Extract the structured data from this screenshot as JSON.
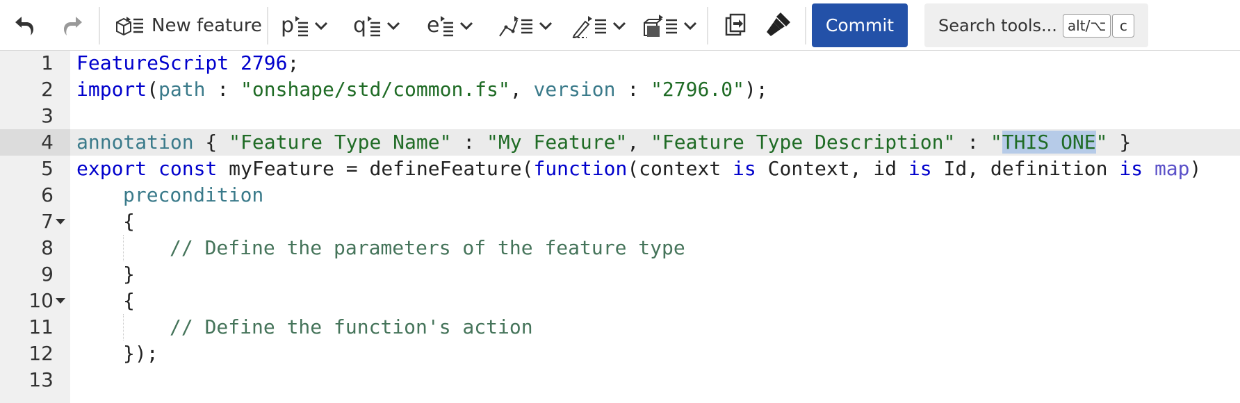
{
  "toolbar": {
    "undo_icon": "undo-icon",
    "redo_icon": "redo-icon",
    "new_feature_label": "New feature",
    "insert_tools": [
      {
        "glyph": "p",
        "name": "insert-parameter"
      },
      {
        "glyph": "q",
        "name": "insert-query"
      },
      {
        "glyph": "e",
        "name": "insert-enum"
      },
      {
        "glyph": "",
        "name": "insert-sketch"
      },
      {
        "glyph": "",
        "name": "insert-geometry"
      },
      {
        "glyph": "",
        "name": "insert-feature"
      }
    ],
    "commit_label": "Commit",
    "search_placeholder": "Search tools...",
    "search_shortcut_1": "alt/⌥",
    "search_shortcut_2": "c"
  },
  "editor": {
    "active_line": 4,
    "selected_text": "THIS ONE",
    "lines": [
      {
        "n": "1"
      },
      {
        "n": "2"
      },
      {
        "n": "3"
      },
      {
        "n": "4"
      },
      {
        "n": "5"
      },
      {
        "n": "6"
      },
      {
        "n": "7",
        "fold": true
      },
      {
        "n": "8"
      },
      {
        "n": "9"
      },
      {
        "n": "10",
        "fold": true
      },
      {
        "n": "11"
      },
      {
        "n": "12"
      },
      {
        "n": "13"
      }
    ],
    "code": {
      "l1_kw": "FeatureScript 2796",
      "l1_end": ";",
      "l2_kw": "import",
      "l2_a": "(",
      "l2_p1": "path",
      "l2_b": " : ",
      "l2_s1": "\"onshape/std/common.fs\"",
      "l2_c": ", ",
      "l2_p2": "version",
      "l2_d": " : ",
      "l2_s2": "\"2796.0\"",
      "l2_e": ");",
      "l4_kw": "annotation",
      "l4_a": " { ",
      "l4_s1": "\"Feature Type Name\"",
      "l4_b": " : ",
      "l4_s2": "\"My Feature\"",
      "l4_c": ", ",
      "l4_s3": "\"Feature Type Description\"",
      "l4_d": " : ",
      "l4_s4a": "\"",
      "l4_sel": "THIS ONE",
      "l4_s4b": "\"",
      "l4_e": " }",
      "l5_k1": "export",
      "l5_sp1": " ",
      "l5_k2": "const",
      "l5_a": " myFeature = defineFeature(",
      "l5_k3": "function",
      "l5_b": "(context ",
      "l5_k4": "is",
      "l5_c": " Context, id ",
      "l5_k5": "is",
      "l5_d": " Id, definition ",
      "l5_k6": "is",
      "l5_e": " ",
      "l5_k7": "map",
      "l5_f": ")",
      "l6_pre": "precondition",
      "l7": "{",
      "l8": "// Define the parameters of the feature type",
      "l9": "}",
      "l10": "{",
      "l11": "// Define the function's action",
      "l12": "});"
    }
  }
}
